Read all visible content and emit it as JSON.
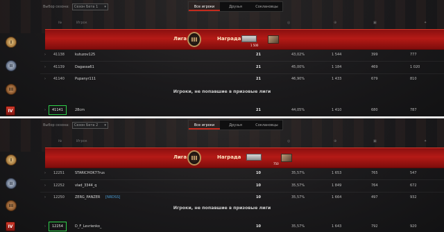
{
  "panels": [
    {
      "season_label": "Выбор сезона:",
      "season_value": "Сезон Бета 1",
      "tabs": [
        "Все игроки",
        "Друзья",
        "Соклановцы"
      ],
      "columns": [
        "№",
        "Игрок"
      ],
      "league_label": "Лига",
      "league_numeral": "III",
      "reward_label": "Награда",
      "reward_qty": "1 500",
      "rows": [
        {
          "rank": "41138",
          "player": "kutuzov125",
          "clan": "",
          "battles": "21",
          "pct": "43,02%",
          "c3": "1 544",
          "c4": "399",
          "c5": "777"
        },
        {
          "rank": "41139",
          "player": "Dagassa61",
          "clan": "",
          "battles": "21",
          "pct": "45,00%",
          "c3": "1 184",
          "c4": "469",
          "c5": "1 020"
        },
        {
          "rank": "41140",
          "player": "Pupanyr111",
          "clan": "",
          "battles": "21",
          "pct": "46,90%",
          "c3": "1 433",
          "c4": "679",
          "c5": "810"
        }
      ],
      "notice": "Игроки, не попавшие в призовые лиги",
      "me": {
        "rank": "41141",
        "player": "28cm",
        "clan": "",
        "battles": "21",
        "pct": "44,05%",
        "c3": "1 410",
        "c4": "680",
        "c5": "787"
      }
    },
    {
      "season_label": "Выбор сезона:",
      "season_value": "Сезон Бета 2",
      "tabs": [
        "Все игроки",
        "Друзья",
        "Соклановцы"
      ],
      "columns": [
        "№",
        "Игрок"
      ],
      "league_label": "Лига",
      "league_numeral": "III",
      "reward_label": "Награда",
      "reward_qty": "750",
      "rows": [
        {
          "rank": "12251",
          "player": "STARICHOK77rus",
          "clan": "",
          "battles": "10",
          "pct": "35,57%",
          "c3": "1 653",
          "c4": "765",
          "c5": "547"
        },
        {
          "rank": "12252",
          "player": "vlad_3344_q",
          "clan": "",
          "battles": "10",
          "pct": "35,57%",
          "c3": "1 849",
          "c4": "764",
          "c5": "672"
        },
        {
          "rank": "12250",
          "player": "ZERG_PANZER",
          "clan": "[NRDSS]",
          "battles": "10",
          "pct": "35,57%",
          "c3": "1 664",
          "c4": "497",
          "c5": "932"
        }
      ],
      "notice": "Игроки, не попавшие в призовые лиги",
      "me": {
        "rank": "12254",
        "player": "D_F_Levrienko_",
        "clan": "",
        "battles": "10",
        "pct": "35,57%",
        "c3": "1 643",
        "c4": "792",
        "c5": "920"
      }
    }
  ],
  "medals": [
    "I",
    "II",
    "III",
    "IV"
  ],
  "colors": {
    "league_red": "#b51a16",
    "highlight_green": "#2fd14a",
    "clan_blue": "#4a9fd8"
  }
}
